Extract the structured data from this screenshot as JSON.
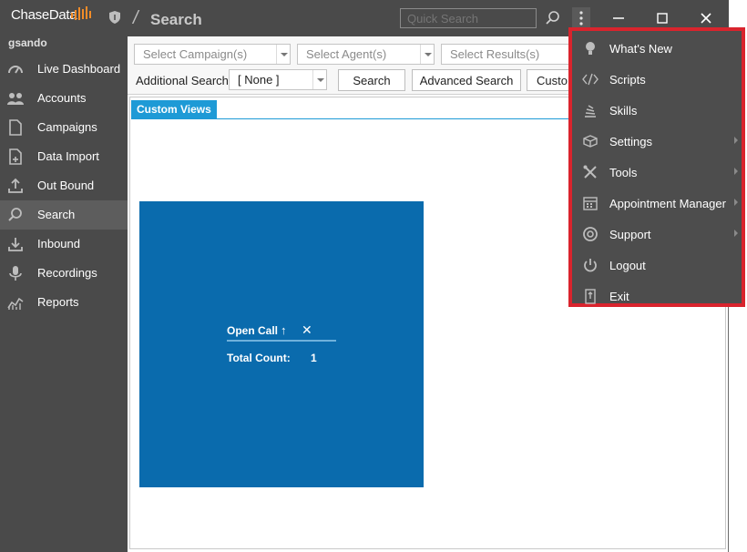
{
  "app": {
    "brand": "ChaseData",
    "user": "gsando",
    "page_title": "Search",
    "quick_search_placeholder": "Quick Search"
  },
  "window_controls": {
    "minimize": "minimize-icon",
    "maximize": "maximize-icon",
    "close": "close-icon"
  },
  "sidebar": {
    "items": [
      {
        "label": "Live Dashboard",
        "icon": "dashboard-gauge-icon"
      },
      {
        "label": "Accounts",
        "icon": "users-icon"
      },
      {
        "label": "Campaigns",
        "icon": "document-icon"
      },
      {
        "label": "Data Import",
        "icon": "import-file-icon"
      },
      {
        "label": "Out Bound",
        "icon": "upload-icon"
      },
      {
        "label": "Search",
        "icon": "search-icon",
        "active": true
      },
      {
        "label": "Inbound",
        "icon": "download-icon"
      },
      {
        "label": "Recordings",
        "icon": "microphone-icon"
      },
      {
        "label": "Reports",
        "icon": "chart-icon"
      }
    ]
  },
  "filters": {
    "campaign_placeholder": "Select Campaign(s)",
    "agent_placeholder": "Select Agent(s)",
    "results_placeholder": "Select Results(s)",
    "additional_search_label": "Additional Search:",
    "additional_search_value": "[ None ]",
    "search_button": "Search",
    "advanced_search_button": "Advanced Search",
    "custom_button": "Custo"
  },
  "views": {
    "tab_label": "Custom Views",
    "tile": {
      "title": "Open Call",
      "up_symbol": "↑",
      "close_symbol": "✕",
      "count_label": "Total Count:",
      "count_value": "1",
      "color": "#0a6bad"
    }
  },
  "menu": {
    "highlight_color": "#d9242d",
    "items": [
      {
        "label": "What's New",
        "icon": "lightbulb-icon",
        "submenu": false
      },
      {
        "label": "Scripts",
        "icon": "code-icon",
        "submenu": false
      },
      {
        "label": "Skills",
        "icon": "stack-icon",
        "submenu": false
      },
      {
        "label": "Settings",
        "icon": "cube-icon",
        "submenu": true
      },
      {
        "label": "Tools",
        "icon": "tools-icon",
        "submenu": true
      },
      {
        "label": "Appointment Manager",
        "icon": "calendar-icon",
        "submenu": true
      },
      {
        "label": "Support",
        "icon": "lifebuoy-icon",
        "submenu": true
      },
      {
        "label": "Logout",
        "icon": "power-icon",
        "submenu": false
      },
      {
        "label": "Exit",
        "icon": "exit-door-icon",
        "submenu": false
      }
    ]
  }
}
